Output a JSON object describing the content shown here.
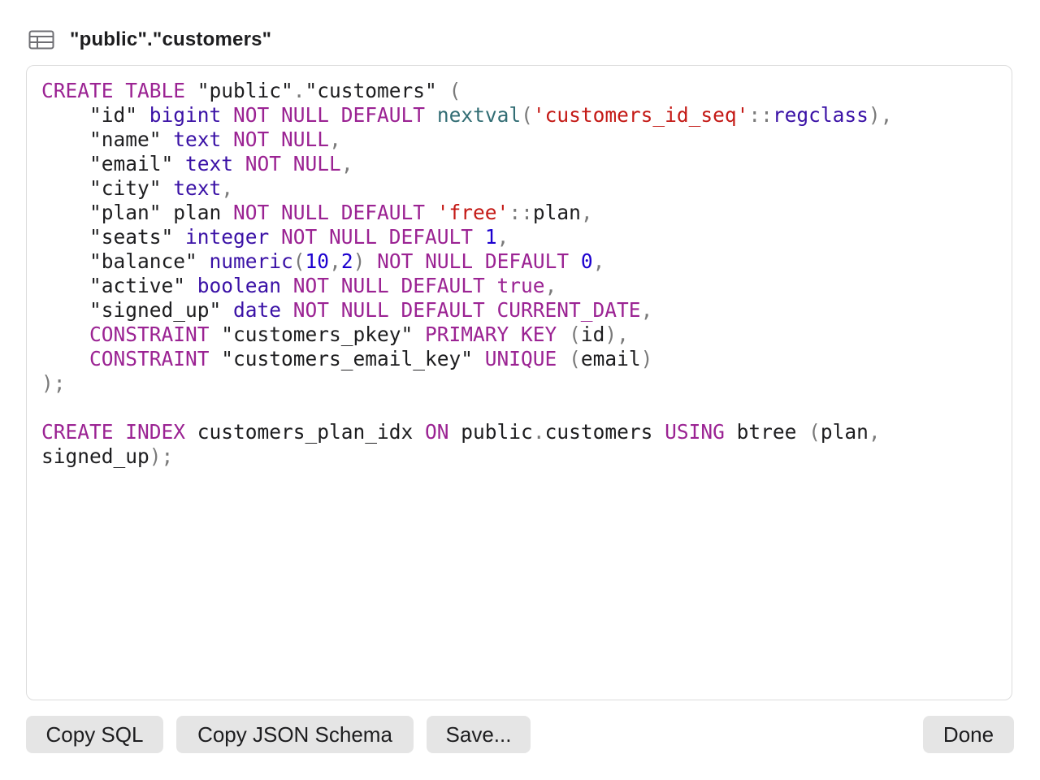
{
  "header": {
    "icon": "table-icon",
    "title": "\"public\".\"customers\""
  },
  "sql": {
    "lines": [
      [
        [
          "kw",
          "CREATE TABLE"
        ],
        [
          "id",
          " \"public\""
        ],
        [
          "pu",
          "."
        ],
        [
          "id",
          "\"customers\" "
        ],
        [
          "pu",
          "("
        ]
      ],
      [
        [
          "id",
          "    \"id\" "
        ],
        [
          "ty",
          "bigint"
        ],
        [
          "id",
          " "
        ],
        [
          "kw",
          "NOT NULL DEFAULT"
        ],
        [
          "id",
          " "
        ],
        [
          "fn",
          "nextval"
        ],
        [
          "pu",
          "("
        ],
        [
          "st",
          "'customers_id_seq'"
        ],
        [
          "pu",
          "::"
        ],
        [
          "ty",
          "regclass"
        ],
        [
          "pu",
          "),"
        ]
      ],
      [
        [
          "id",
          "    \"name\" "
        ],
        [
          "ty",
          "text"
        ],
        [
          "id",
          " "
        ],
        [
          "kw",
          "NOT NULL"
        ],
        [
          "pu",
          ","
        ]
      ],
      [
        [
          "id",
          "    \"email\" "
        ],
        [
          "ty",
          "text"
        ],
        [
          "id",
          " "
        ],
        [
          "kw",
          "NOT NULL"
        ],
        [
          "pu",
          ","
        ]
      ],
      [
        [
          "id",
          "    \"city\" "
        ],
        [
          "ty",
          "text"
        ],
        [
          "pu",
          ","
        ]
      ],
      [
        [
          "id",
          "    \"plan\" plan "
        ],
        [
          "kw",
          "NOT NULL DEFAULT"
        ],
        [
          "id",
          " "
        ],
        [
          "st",
          "'free'"
        ],
        [
          "pu",
          "::"
        ],
        [
          "id",
          "plan"
        ],
        [
          "pu",
          ","
        ]
      ],
      [
        [
          "id",
          "    \"seats\" "
        ],
        [
          "ty",
          "integer"
        ],
        [
          "id",
          " "
        ],
        [
          "kw",
          "NOT NULL DEFAULT"
        ],
        [
          "id",
          " "
        ],
        [
          "nu",
          "1"
        ],
        [
          "pu",
          ","
        ]
      ],
      [
        [
          "id",
          "    \"balance\" "
        ],
        [
          "ty",
          "numeric"
        ],
        [
          "pu",
          "("
        ],
        [
          "nu",
          "10"
        ],
        [
          "pu",
          ","
        ],
        [
          "nu",
          "2"
        ],
        [
          "pu",
          ")"
        ],
        [
          "id",
          " "
        ],
        [
          "kw",
          "NOT NULL DEFAULT"
        ],
        [
          "id",
          " "
        ],
        [
          "nu",
          "0"
        ],
        [
          "pu",
          ","
        ]
      ],
      [
        [
          "id",
          "    \"active\" "
        ],
        [
          "ty",
          "boolean"
        ],
        [
          "id",
          " "
        ],
        [
          "kw",
          "NOT NULL DEFAULT true"
        ],
        [
          "pu",
          ","
        ]
      ],
      [
        [
          "id",
          "    \"signed_up\" "
        ],
        [
          "ty",
          "date"
        ],
        [
          "id",
          " "
        ],
        [
          "kw",
          "NOT NULL DEFAULT CURRENT_DATE"
        ],
        [
          "pu",
          ","
        ]
      ],
      [
        [
          "id",
          "    "
        ],
        [
          "kw",
          "CONSTRAINT"
        ],
        [
          "id",
          " \"customers_pkey\" "
        ],
        [
          "kw",
          "PRIMARY KEY"
        ],
        [
          "id",
          " "
        ],
        [
          "pu",
          "("
        ],
        [
          "id",
          "id"
        ],
        [
          "pu",
          "),"
        ]
      ],
      [
        [
          "id",
          "    "
        ],
        [
          "kw",
          "CONSTRAINT"
        ],
        [
          "id",
          " \"customers_email_key\" "
        ],
        [
          "kw",
          "UNIQUE"
        ],
        [
          "id",
          " "
        ],
        [
          "pu",
          "("
        ],
        [
          "id",
          "email"
        ],
        [
          "pu",
          ")"
        ]
      ],
      [
        [
          "pu",
          ");"
        ]
      ],
      [
        [
          "id",
          ""
        ]
      ],
      [
        [
          "kw",
          "CREATE INDEX"
        ],
        [
          "id",
          " customers_plan_idx "
        ],
        [
          "kw",
          "ON"
        ],
        [
          "id",
          " public"
        ],
        [
          "pu",
          "."
        ],
        [
          "id",
          "customers "
        ],
        [
          "kw",
          "USING"
        ],
        [
          "id",
          " btree "
        ],
        [
          "pu",
          "("
        ],
        [
          "id",
          "plan"
        ],
        [
          "pu",
          ","
        ]
      ],
      [
        [
          "id",
          "signed_up"
        ],
        [
          "pu",
          ");"
        ]
      ]
    ]
  },
  "buttons": {
    "copy_sql": "Copy SQL",
    "copy_json_schema": "Copy JSON Schema",
    "save": "Save...",
    "done": "Done"
  }
}
